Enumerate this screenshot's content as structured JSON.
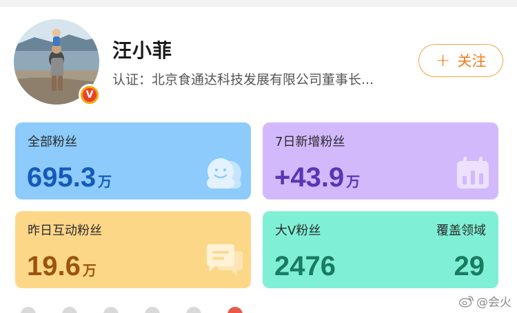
{
  "profile": {
    "name": "汪小菲",
    "verification": "认证：北京食通达科技发展有限公司董事长...",
    "badge_letter": "V",
    "follow_label": "关注",
    "follow_plus": "+"
  },
  "stats": [
    {
      "label": "全部粉丝",
      "value": "695.3",
      "unit": "万",
      "icon": "users-icon"
    },
    {
      "label": "7日新增粉丝",
      "value": "+43.9",
      "unit": "万",
      "icon": "calendar-chart-icon"
    },
    {
      "label": "昨日互动粉丝",
      "value": "19.6",
      "unit": "万",
      "icon": "chat-icon"
    },
    {
      "label": "大V粉丝",
      "value": "2476",
      "label_right": "覆盖领域",
      "value_right": "29"
    }
  ],
  "watermark": "@会火",
  "colors": {
    "accent_orange": "#f07b1b",
    "card_blue": "#8ccbfc",
    "card_purple": "#d2b9fc",
    "card_yellow": "#fdd788",
    "card_teal": "#7ff0d6"
  }
}
